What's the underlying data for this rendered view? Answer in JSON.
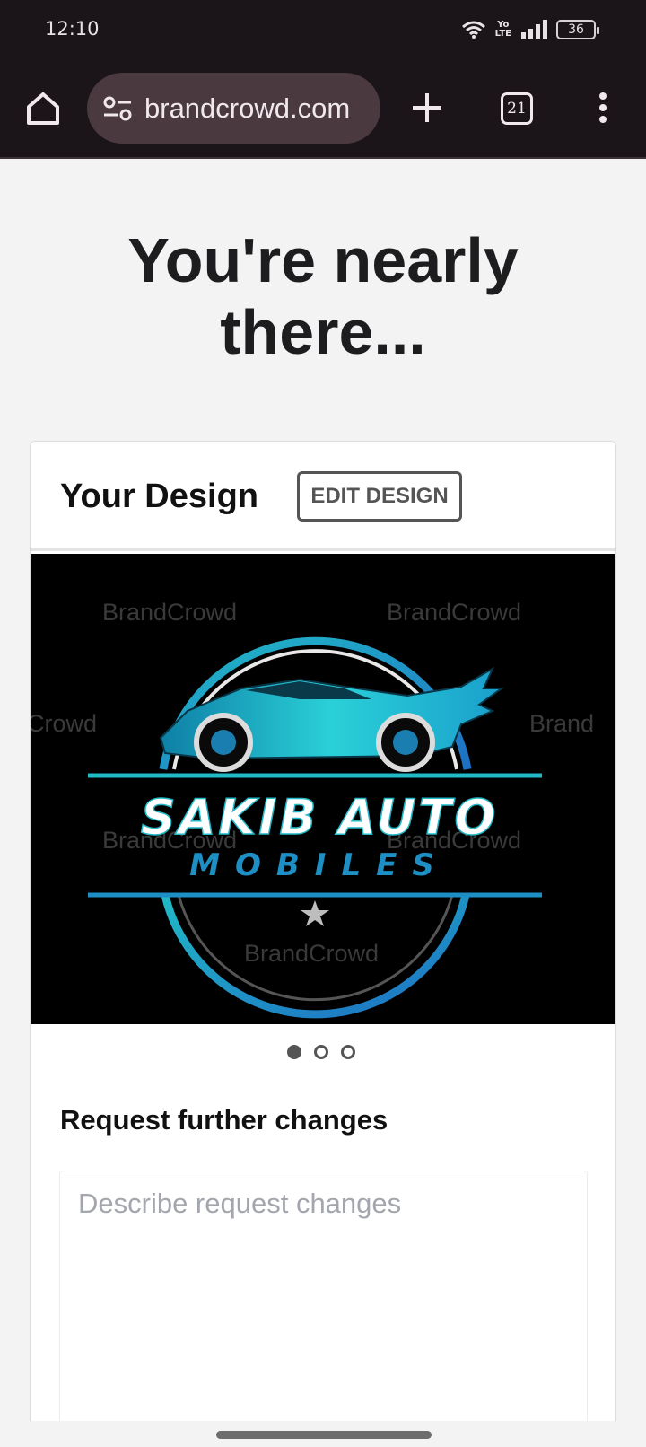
{
  "status_bar": {
    "time": "12:10",
    "volte_top": "Yo",
    "volte_bottom": "LTE",
    "battery": "36"
  },
  "browser": {
    "url": "brandcrowd.com",
    "tab_count": "21"
  },
  "page": {
    "title": "You're nearly there...",
    "card_title": "Your Design",
    "edit_button": "EDIT DESIGN",
    "design": {
      "logo_line1": "SAKIB AUTO",
      "logo_line2": "MOBILES",
      "watermark": "BrandCrowd",
      "watermark_partial_left": "Crowd",
      "watermark_partial_right": "Brand",
      "accent_color": "#21b9c7",
      "secondary_color": "#1d8fc4"
    },
    "carousel": {
      "count": 3,
      "active_index": 0
    },
    "request_label": "Request further changes",
    "request_placeholder": "Describe request changes"
  }
}
